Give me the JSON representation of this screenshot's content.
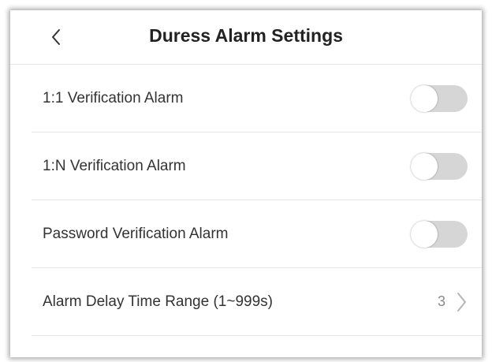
{
  "header": {
    "title": "Duress Alarm Settings",
    "back_icon": "chevron-left-icon"
  },
  "settings": [
    {
      "label": "1:1 Verification Alarm",
      "control": "toggle",
      "enabled": false
    },
    {
      "label": "1:N Verification Alarm",
      "control": "toggle",
      "enabled": false
    },
    {
      "label": "Password Verification Alarm",
      "control": "toggle",
      "enabled": false
    },
    {
      "label": "Alarm Delay Time Range (1~999s)",
      "control": "link",
      "value": "3",
      "icon": "chevron-right-icon"
    }
  ],
  "colors": {
    "toggle_off": "#d6d6d6",
    "divider": "#e6e6e6",
    "text": "#333333",
    "value_text": "#8a8a8a"
  }
}
